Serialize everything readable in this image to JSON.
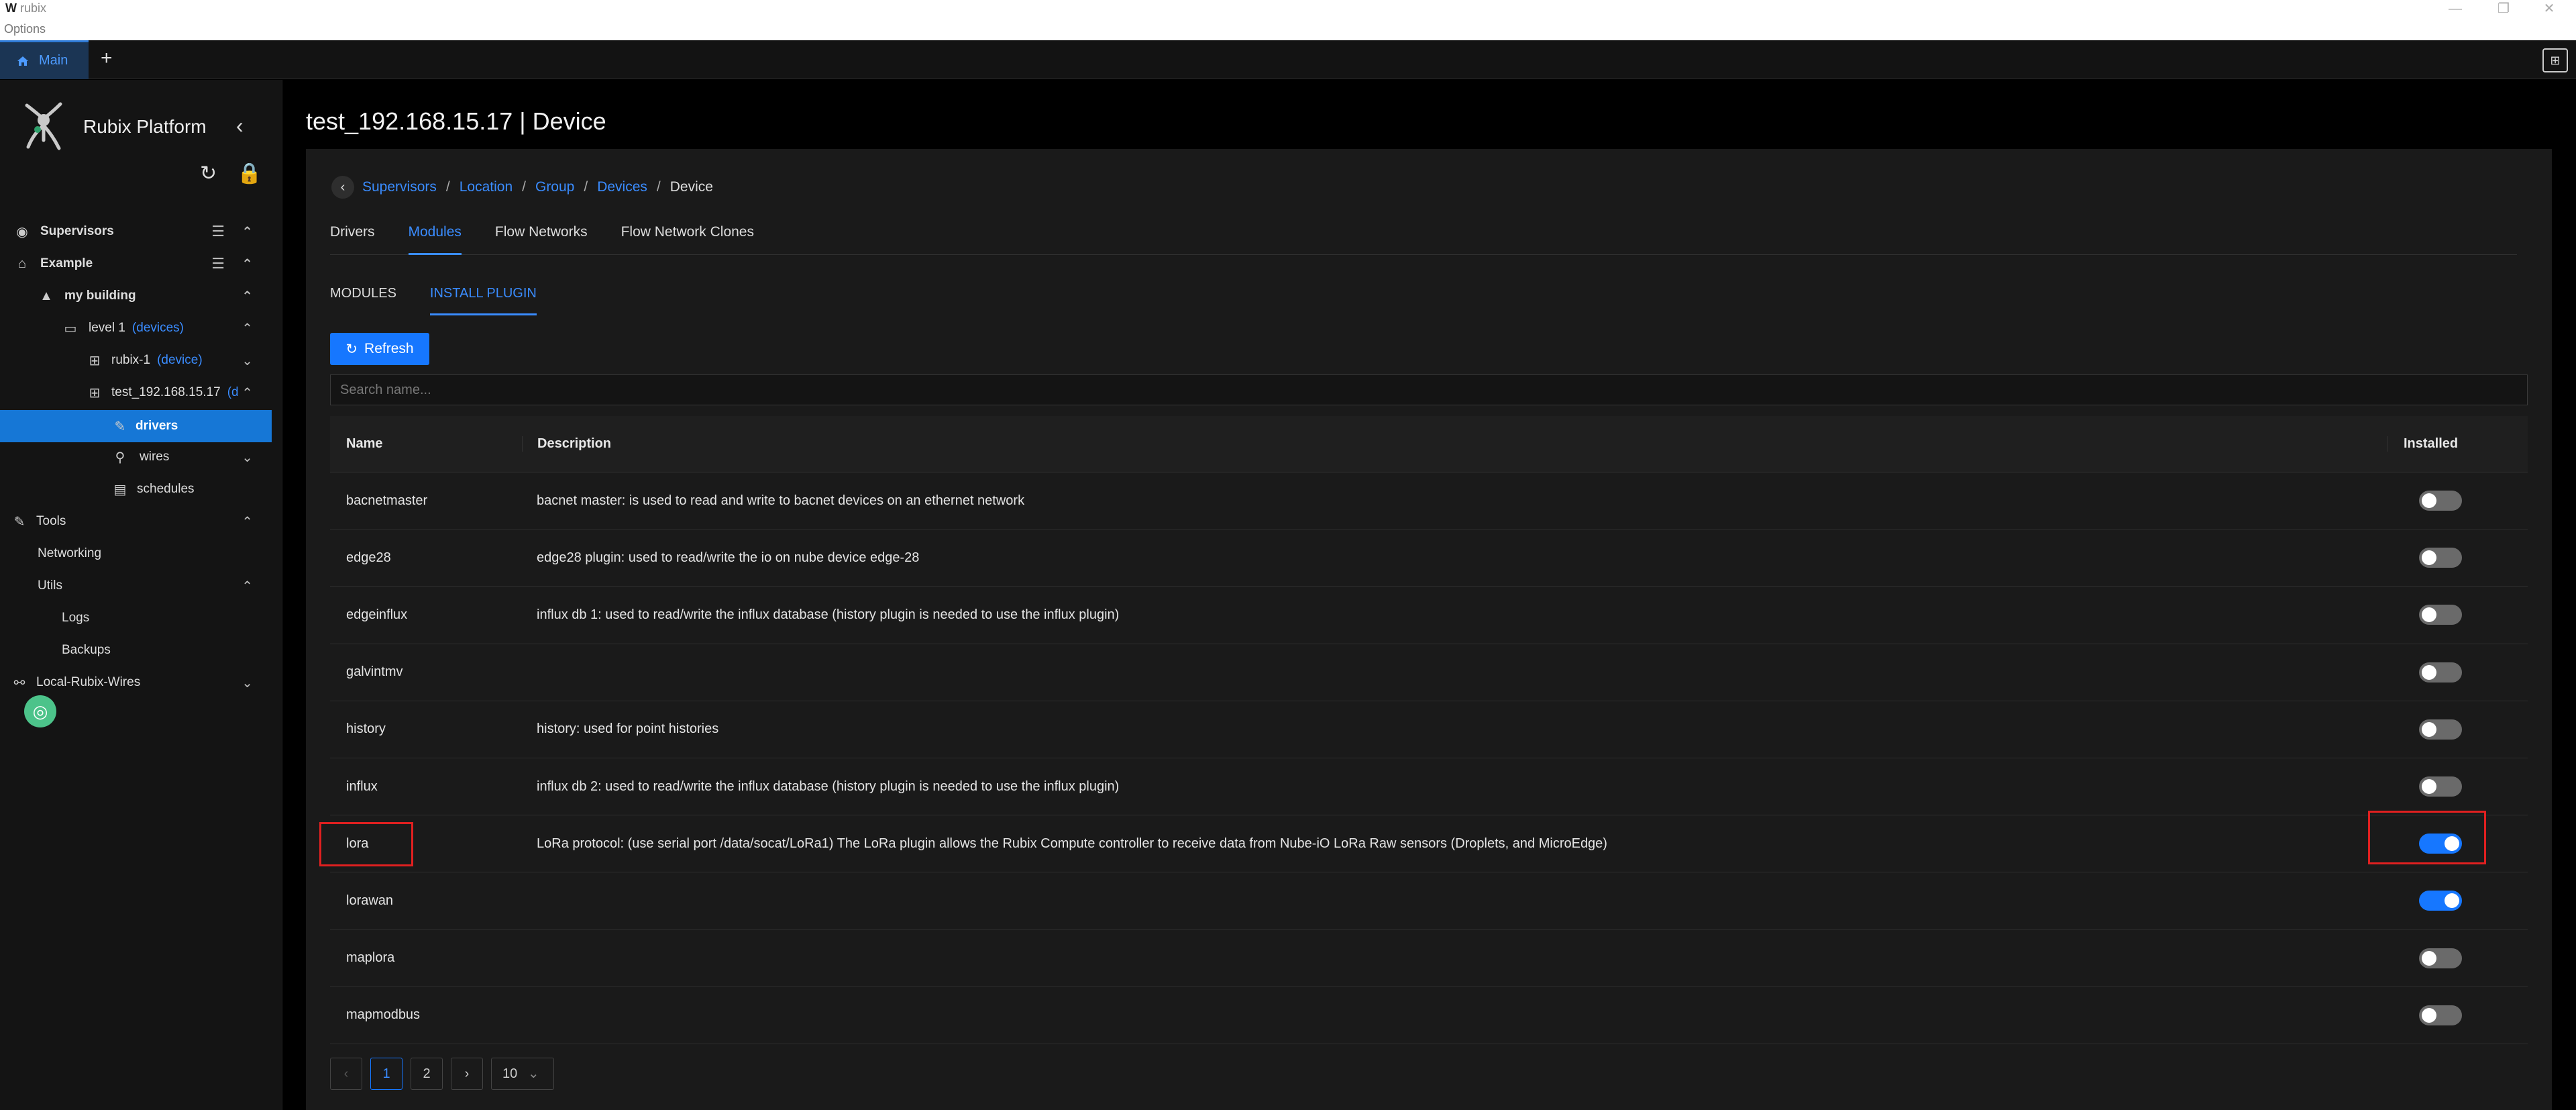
{
  "window": {
    "app_logo": "W",
    "app_name": "rubix",
    "menu_options": "Options",
    "minimize": "—",
    "maximize": "❐",
    "close": "✕"
  },
  "tabs": {
    "main_label": "Main",
    "add_label": "+",
    "layout_icon": "⊞"
  },
  "sidebar": {
    "brand": "Rubix Platform",
    "collapse": "‹",
    "refresh_icon": "↻",
    "lock_icon": "🔒",
    "tree": [
      {
        "label": "Supervisors"
      },
      {
        "label": "Example"
      },
      {
        "label": "my building"
      },
      {
        "label": "level 1",
        "tag": "(devices)"
      },
      {
        "label": "rubix-1",
        "tag": "(device)"
      },
      {
        "label": "test_192.168.15.17",
        "tag": "(d"
      },
      {
        "label": "drivers"
      },
      {
        "label": "wires"
      },
      {
        "label": "schedules"
      },
      {
        "label": "Tools"
      },
      {
        "label": "Networking"
      },
      {
        "label": "Utils"
      },
      {
        "label": "Logs"
      },
      {
        "label": "Backups"
      },
      {
        "label": "Local-Rubix-Wires"
      }
    ]
  },
  "page": {
    "title": "test_192.168.15.17 | Device"
  },
  "breadcrumb": [
    "Supervisors",
    "Location",
    "Group",
    "Devices",
    "Device"
  ],
  "top_tabs": [
    "Drivers",
    "Modules",
    "Flow Networks",
    "Flow Network Clones"
  ],
  "sub_tabs": [
    "MODULES",
    "INSTALL PLUGIN"
  ],
  "refresh_label": "Refresh",
  "search": {
    "placeholder": "Search name..."
  },
  "table": {
    "headers": {
      "name": "Name",
      "description": "Description",
      "installed": "Installed"
    },
    "rows": [
      {
        "name": "bacnetmaster",
        "description": "bacnet master: is used to read and write to bacnet devices on an ethernet network",
        "installed": false
      },
      {
        "name": "edge28",
        "description": "edge28 plugin: used to read/write the io on nube device edge-28",
        "installed": false
      },
      {
        "name": "edgeinflux",
        "description": "influx db 1: used to read/write the influx database (history plugin is needed to use the influx plugin)",
        "installed": false
      },
      {
        "name": "galvintmv",
        "description": "",
        "installed": false
      },
      {
        "name": "history",
        "description": "history: used for point histories",
        "installed": false
      },
      {
        "name": "influx",
        "description": "influx db 2: used to read/write the influx database (history plugin is needed to use the influx plugin)",
        "installed": false
      },
      {
        "name": "lora",
        "description": "LoRa protocol: (use serial port /data/socat/LoRa1) The LoRa plugin allows the Rubix Compute controller to receive data from Nube-iO LoRa Raw sensors (Droplets, and MicroEdge)",
        "installed": true
      },
      {
        "name": "lorawan",
        "description": "",
        "installed": true
      },
      {
        "name": "maplora",
        "description": "",
        "installed": false
      },
      {
        "name": "mapmodbus",
        "description": "",
        "installed": false
      }
    ]
  },
  "pagination": {
    "prev": "‹",
    "pages": [
      "1",
      "2"
    ],
    "next": "›",
    "page_size": "10"
  }
}
